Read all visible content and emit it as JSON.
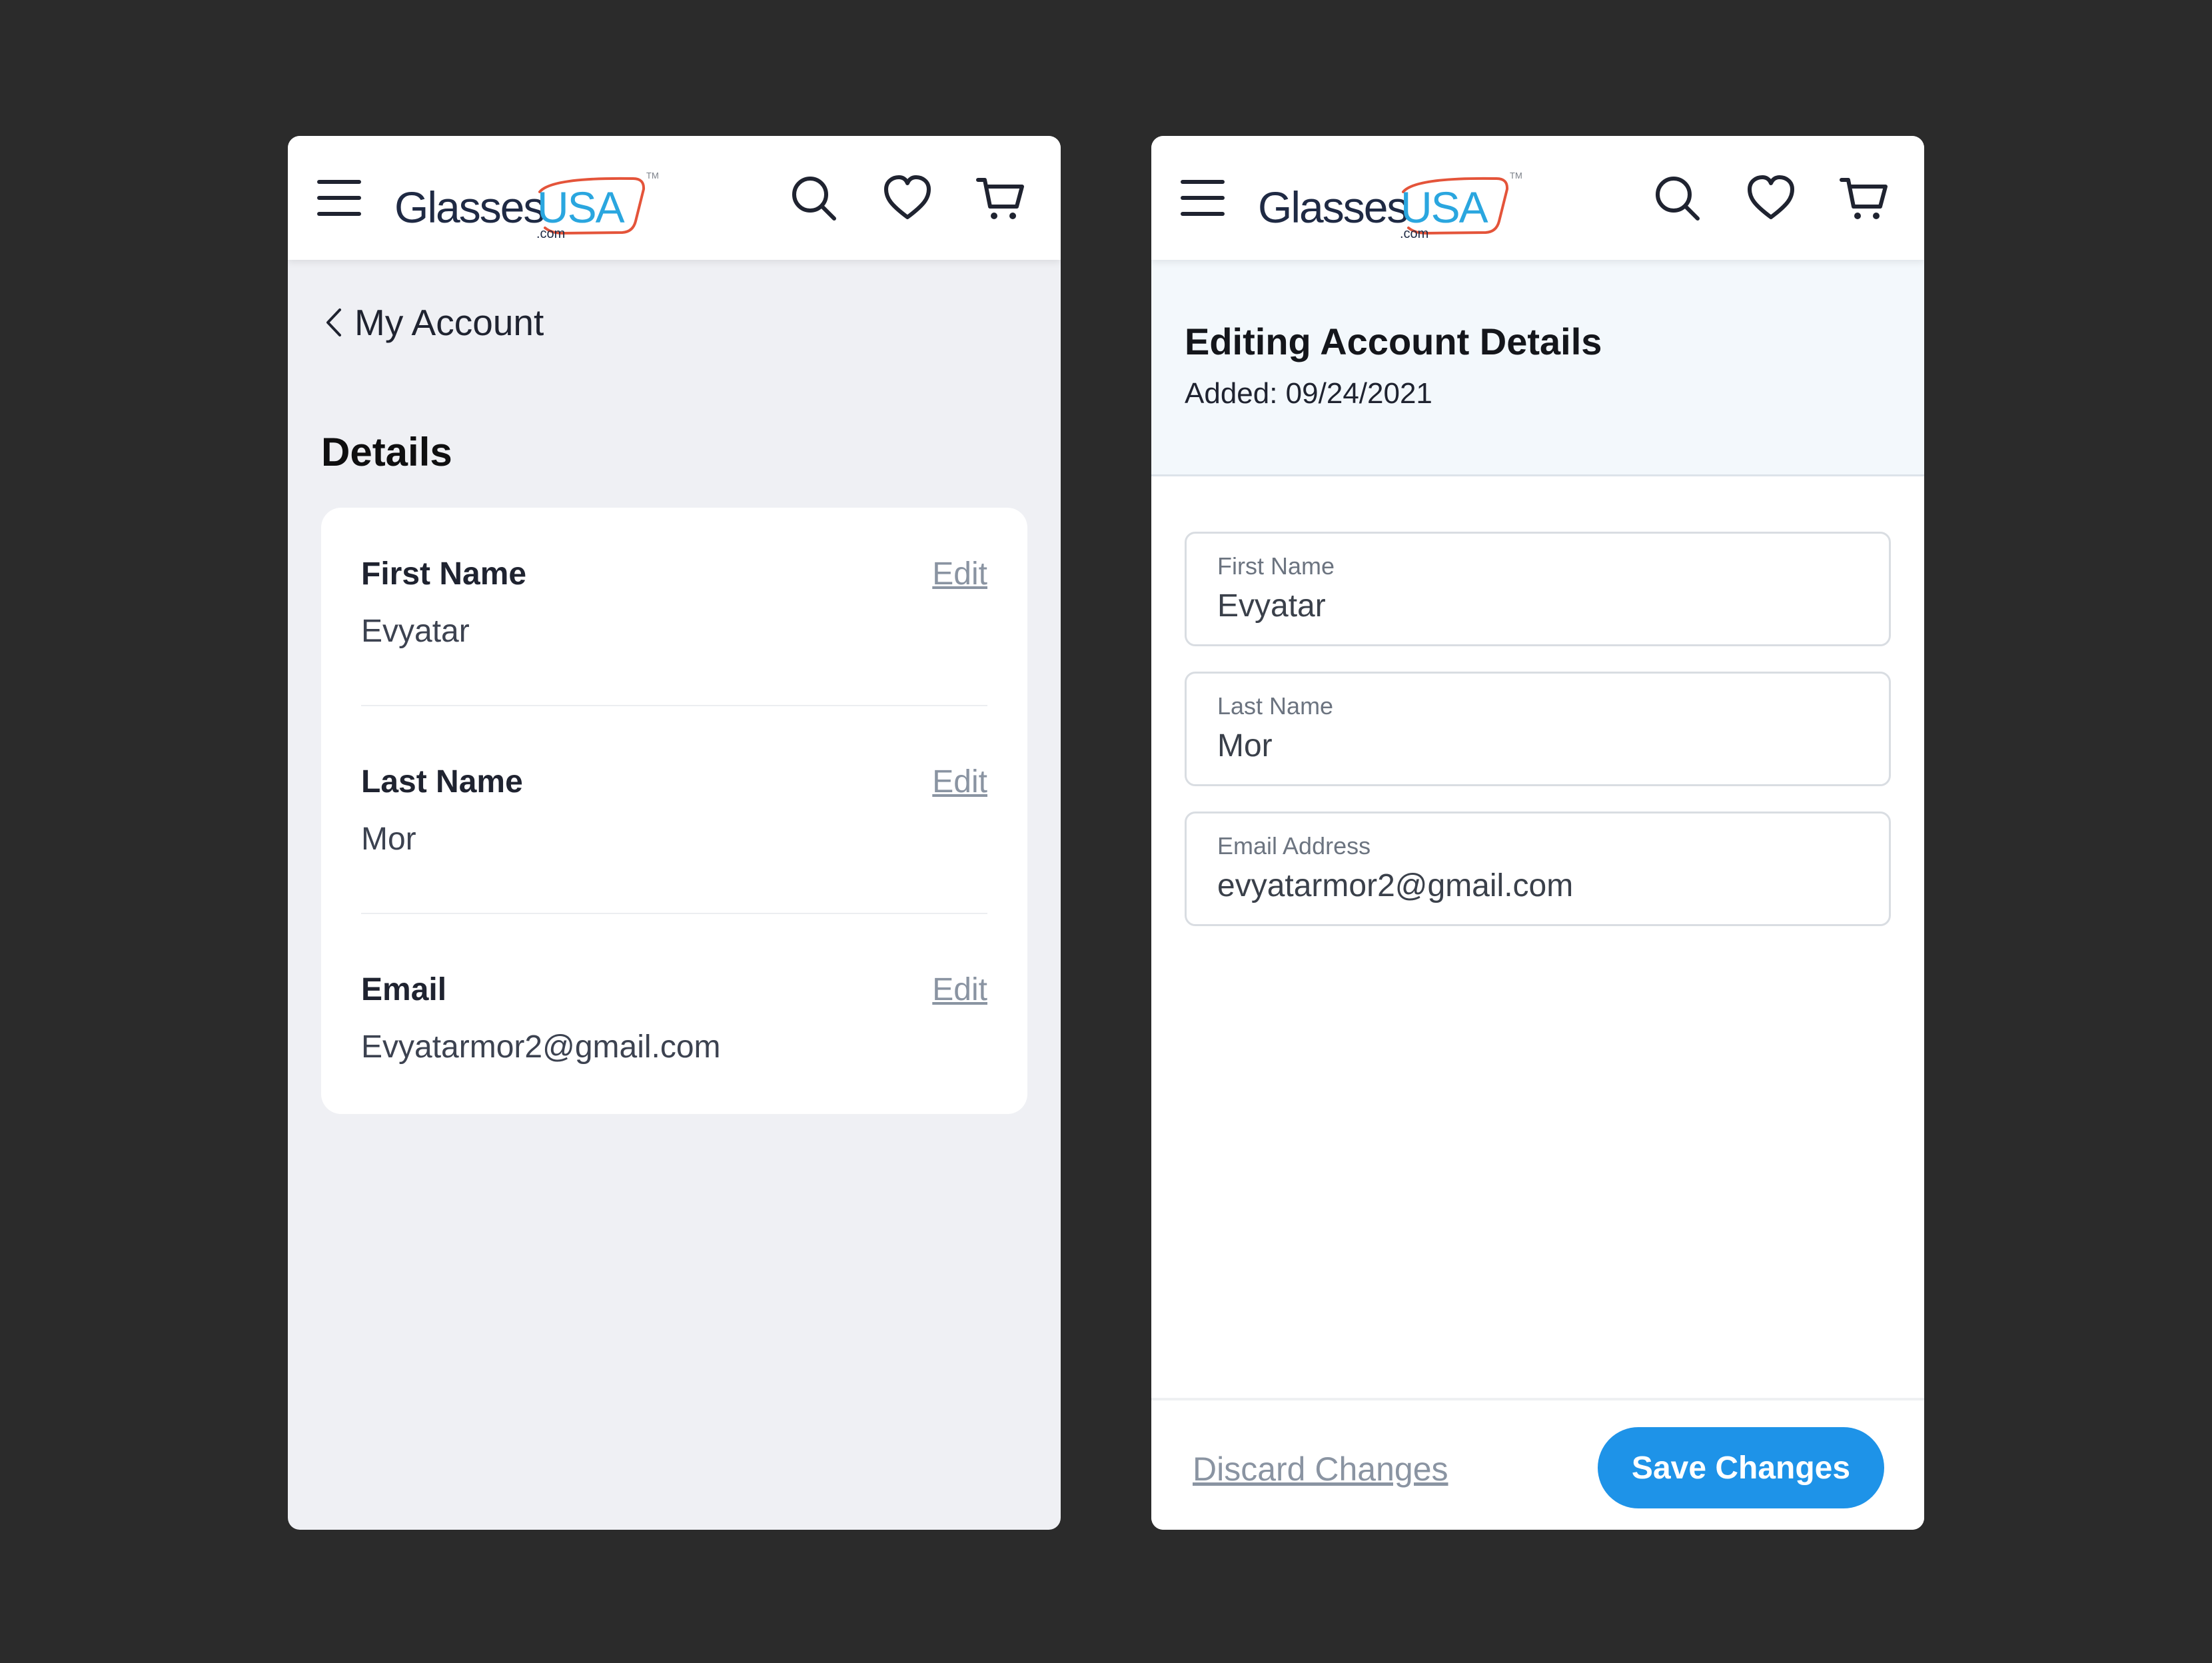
{
  "brand": {
    "name_part1": "Glasses",
    "name_part2": "USA",
    "suffix": ".com",
    "tm": "TM",
    "colors": {
      "dark": "#1f2a44",
      "blue": "#2aa6df",
      "red": "#e4543a"
    }
  },
  "header_icons": [
    "menu-icon",
    "search-icon",
    "heart-icon",
    "cart-icon"
  ],
  "left": {
    "back_label": "My Account",
    "section_title": "Details",
    "rows": [
      {
        "label": "First Name",
        "value": "Evyatar",
        "edit": "Edit"
      },
      {
        "label": "Last Name",
        "value": "Mor",
        "edit": "Edit"
      },
      {
        "label": "Email",
        "value": "Evyatarmor2@gmail.com",
        "edit": "Edit"
      }
    ]
  },
  "right": {
    "title": "Editing Account Details",
    "added": "Added: 09/24/2021",
    "fields": [
      {
        "label": "First Name",
        "value": "Evyatar"
      },
      {
        "label": "Last Name",
        "value": "Mor"
      },
      {
        "label": "Email Address",
        "value": "evyatarmor2@gmail.com"
      }
    ],
    "discard": "Discard Changes",
    "save": "Save Changes",
    "accent": "#1e93e8"
  }
}
